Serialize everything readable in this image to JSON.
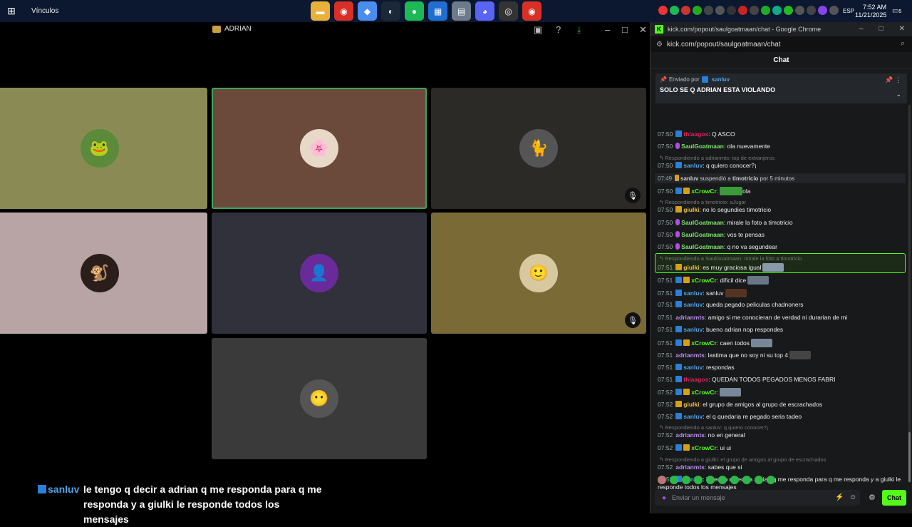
{
  "taskbar": {
    "start": "⊞",
    "links_label": "Vínculos",
    "apps": [
      {
        "name": "file-explorer-icon",
        "glyph": "▬",
        "color": "#e8b23a"
      },
      {
        "name": "chrome-icon",
        "glyph": "◉",
        "color": "#d93025"
      },
      {
        "name": "copilot-icon",
        "glyph": "◆",
        "color": "#4a8df0"
      },
      {
        "name": "steam-icon",
        "glyph": "◐",
        "color": "#1b2838"
      },
      {
        "name": "spotify-icon",
        "glyph": "●",
        "color": "#1db954"
      },
      {
        "name": "store-icon",
        "glyph": "▦",
        "color": "#1f6fd0"
      },
      {
        "name": "files-icon",
        "glyph": "▤",
        "color": "#6c7a89"
      },
      {
        "name": "discord-icon",
        "glyph": "◕",
        "color": "#5865f2"
      },
      {
        "name": "obs-icon",
        "glyph": "◎",
        "color": "#333333"
      },
      {
        "name": "chrome-profile-icon",
        "glyph": "◉",
        "color": "#d93025"
      }
    ],
    "tray": [
      {
        "name": "tray-red-icon",
        "color": "#e33"
      },
      {
        "name": "tray-spotify-icon",
        "color": "#1db954"
      },
      {
        "name": "tray-vpn-icon",
        "color": "#c33"
      },
      {
        "name": "tray-green-icon",
        "color": "#2a2"
      },
      {
        "name": "tray-dot-icon",
        "color": "#444"
      },
      {
        "name": "tray-net-icon",
        "color": "#555"
      },
      {
        "name": "tray-b-icon",
        "color": "#333"
      },
      {
        "name": "tray-shield-icon",
        "color": "#c22"
      },
      {
        "name": "tray-mic-icon",
        "color": "#444"
      },
      {
        "name": "tray-nvidia-icon",
        "color": "#2a2"
      },
      {
        "name": "tray-green2-icon",
        "color": "#1a8"
      },
      {
        "name": "tray-green3-icon",
        "color": "#2b2"
      },
      {
        "name": "tray-display-icon",
        "color": "#555"
      },
      {
        "name": "tray-monitor-icon",
        "color": "#444"
      },
      {
        "name": "tray-pen-icon",
        "color": "#84e"
      },
      {
        "name": "tray-wifi-icon",
        "color": "#555"
      }
    ],
    "lang": "ESP",
    "time": "7:52 AM",
    "date": "11/21/2025",
    "notif_count": "5"
  },
  "discord": {
    "channel_name": "ADRIAN",
    "caption": {
      "user": "sanluv",
      "text": "le tengo q decir a adrian q me responda para q me responda y a giulki le responde todos los mensajes"
    }
  },
  "tiles": [
    {
      "name": "participant-tile-1",
      "bg": "#8a8a55",
      "avatar_bg": "#5a8a3a",
      "glyph": "🐸",
      "muted": false,
      "speaking": false
    },
    {
      "name": "participant-tile-2",
      "bg": "#6b4a3c",
      "avatar_bg": "#e8d8c8",
      "glyph": "🌸",
      "muted": false,
      "speaking": true
    },
    {
      "name": "participant-tile-3",
      "bg": "#2c2a26",
      "avatar_bg": "#555",
      "glyph": "🐈",
      "muted": true,
      "speaking": false
    },
    {
      "name": "participant-tile-4",
      "bg": "#b8a4a4",
      "avatar_bg": "#2a1e1a",
      "glyph": "🐒",
      "muted": false,
      "speaking": false
    },
    {
      "name": "participant-tile-5",
      "bg": "#30313a",
      "avatar_bg": "#6a2a9a",
      "glyph": "👤",
      "muted": false,
      "speaking": false
    },
    {
      "name": "participant-tile-6",
      "bg": "#7a6a35",
      "avatar_bg": "#d8c8a0",
      "glyph": "🙂",
      "muted": true,
      "speaking": false
    },
    {
      "name": "participant-tile-7",
      "bg": "#3a3a3a",
      "avatar_bg": "#555",
      "glyph": "😶",
      "muted": false,
      "speaking": false
    }
  ],
  "chrome": {
    "title": "kick.com/popout/saulgoatmaan/chat - Google Chrome",
    "url": "kick.com/popout/saulgoatmaan/chat",
    "chat_header": "Chat",
    "pinned": {
      "label": "Enviado por",
      "user": "sanluv",
      "message": "SOLO SE Q ADRIAN ESTA VIOLANDO"
    },
    "input_placeholder": "Enviar un mensaje",
    "send_label": "Chat"
  },
  "chat": [
    {
      "kind": "msg",
      "ts": "07:50",
      "badges": [
        "blue"
      ],
      "user": "thiaagos",
      "color": "#e0245e",
      "text": ": Q ASCO"
    },
    {
      "kind": "msg",
      "ts": "07:50",
      "badges": [
        "mic"
      ],
      "user": "SaulGoatmaan",
      "color": "#7ce86a",
      "text": ": ola nuevamente"
    },
    {
      "kind": "reply",
      "text": "↰ Respondiendo a adrianmts: top de extranjeros"
    },
    {
      "kind": "msg",
      "ts": "07:50",
      "badges": [
        "blue"
      ],
      "user": "sanluv",
      "color": "#4fa3e6",
      "text": ": q quiero conocer?¡"
    },
    {
      "kind": "sys",
      "ts": "07:49",
      "user": "sanluv",
      "text": "suspendió a",
      "target": "timotricio",
      "tail": "por 5 minutos"
    },
    {
      "kind": "msg",
      "ts": "07:50",
      "badges": [
        "blue",
        "gold"
      ],
      "user": "xCrowCr",
      "color": "#53fc18",
      "text": ":",
      "emote": "#3b9a3b",
      "after": "ola"
    },
    {
      "kind": "reply",
      "text": "↰ Respondiendo a timotricio: aJugar"
    },
    {
      "kind": "msg",
      "ts": "07:50",
      "badges": [
        "gold"
      ],
      "user": "giulki",
      "color": "#f0c040",
      "text": ": no lo segundies timotricio"
    },
    {
      "kind": "msg",
      "ts": "07:50",
      "badges": [
        "mic"
      ],
      "user": "SaulGoatmaan",
      "color": "#7ce86a",
      "text": ": mirale la foto a timotricio"
    },
    {
      "kind": "msg",
      "ts": "07:50",
      "badges": [
        "mic"
      ],
      "user": "SaulGoatmaan",
      "color": "#7ce86a",
      "text": ": vos te pensas"
    },
    {
      "kind": "msg",
      "ts": "07:50",
      "badges": [
        "mic"
      ],
      "user": "SaulGoatmaan",
      "color": "#7ce86a",
      "text": ": q no va segundear"
    },
    {
      "kind": "reply",
      "text": "↰ Respondiendo a SaulGoatmaan: mirale la foto a timotricio"
    },
    {
      "kind": "msg",
      "ts": "07:51",
      "badges": [
        "gold"
      ],
      "user": "giulki",
      "color": "#f0c040",
      "text": ": es muy graciosa igual",
      "emote": "#8899aa"
    },
    {
      "kind": "msg",
      "ts": "07:51",
      "badges": [
        "blue",
        "gold"
      ],
      "user": "xCrowCr",
      "color": "#53fc18",
      "text": ": dificil dice",
      "emote": "#667788"
    },
    {
      "kind": "msg",
      "ts": "07:51",
      "badges": [
        "blue"
      ],
      "user": "sanluv",
      "color": "#4fa3e6",
      "text": ": sanluv",
      "emote": "#553322"
    },
    {
      "kind": "msg",
      "ts": "07:51",
      "badges": [
        "blue"
      ],
      "user": "sanluv",
      "color": "#4fa3e6",
      "text": ": queda pegado peliculas chadnoners"
    },
    {
      "kind": "msg",
      "ts": "07:51",
      "badges": [],
      "user": "adrianmts",
      "color": "#b98cf0",
      "text": ": amigo si me conocieran de verdad ni durarian de mi"
    },
    {
      "kind": "msg",
      "ts": "07:51",
      "badges": [
        "blue"
      ],
      "user": "sanluv",
      "color": "#4fa3e6",
      "text": ": bueno adrian nop respondes"
    },
    {
      "kind": "msg",
      "ts": "07:51",
      "badges": [
        "blue",
        "gold"
      ],
      "user": "xCrowCr",
      "color": "#53fc18",
      "text": ": caen todos",
      "emote": "#778899"
    },
    {
      "kind": "msg",
      "ts": "07:51",
      "badges": [],
      "user": "adrianmts",
      "color": "#b98cf0",
      "text": ": lastima que no soy ni su top 4",
      "emote": "#444444"
    },
    {
      "kind": "msg",
      "ts": "07:51",
      "badges": [
        "blue"
      ],
      "user": "sanluv",
      "color": "#4fa3e6",
      "text": ": respondas"
    },
    {
      "kind": "msg",
      "ts": "07:51",
      "badges": [
        "blue"
      ],
      "user": "thiaagos",
      "color": "#e0245e",
      "text": ": QUEDAN TODOS PEGADOS MENOS FABRI"
    },
    {
      "kind": "msg",
      "ts": "07:52",
      "badges": [
        "blue",
        "gold"
      ],
      "user": "xCrowCr",
      "color": "#53fc18",
      "text": ":",
      "emote": "#778899"
    },
    {
      "kind": "msg",
      "ts": "07:52",
      "badges": [
        "gold"
      ],
      "user": "giulki",
      "color": "#f0c040",
      "text": ": el grupo de amigos al grupo de escrachados"
    },
    {
      "kind": "msg",
      "ts": "07:52",
      "badges": [
        "blue"
      ],
      "user": "sanluv",
      "color": "#4fa3e6",
      "text": ": el q quedaria re pegado seria tadeo"
    },
    {
      "kind": "reply",
      "text": "↰ Respondiendo a sanluv: q quiero conocer?¡"
    },
    {
      "kind": "msg",
      "ts": "07:52",
      "badges": [],
      "user": "adrianmts",
      "color": "#b98cf0",
      "text": ": no en general"
    },
    {
      "kind": "msg",
      "ts": "07:52",
      "badges": [
        "blue",
        "gold"
      ],
      "user": "xCrowCr",
      "color": "#53fc18",
      "text": ": ui ui"
    },
    {
      "kind": "reply",
      "text": "↰ Respondiendo a giulki: el grupo de amigos al grupo de escrachados"
    },
    {
      "kind": "msg",
      "ts": "07:52",
      "badges": [],
      "user": "adrianmts",
      "color": "#b98cf0",
      "text": ": sabes que si"
    },
    {
      "kind": "msg",
      "ts": "07:52",
      "badges": [
        "blue"
      ],
      "user": "sanluv",
      "color": "#4fa3e6",
      "text": ": le tengo q decir a adrian q me responda para q me responda y a giulki le responde todos los mensajes",
      "wrap": true
    }
  ]
}
